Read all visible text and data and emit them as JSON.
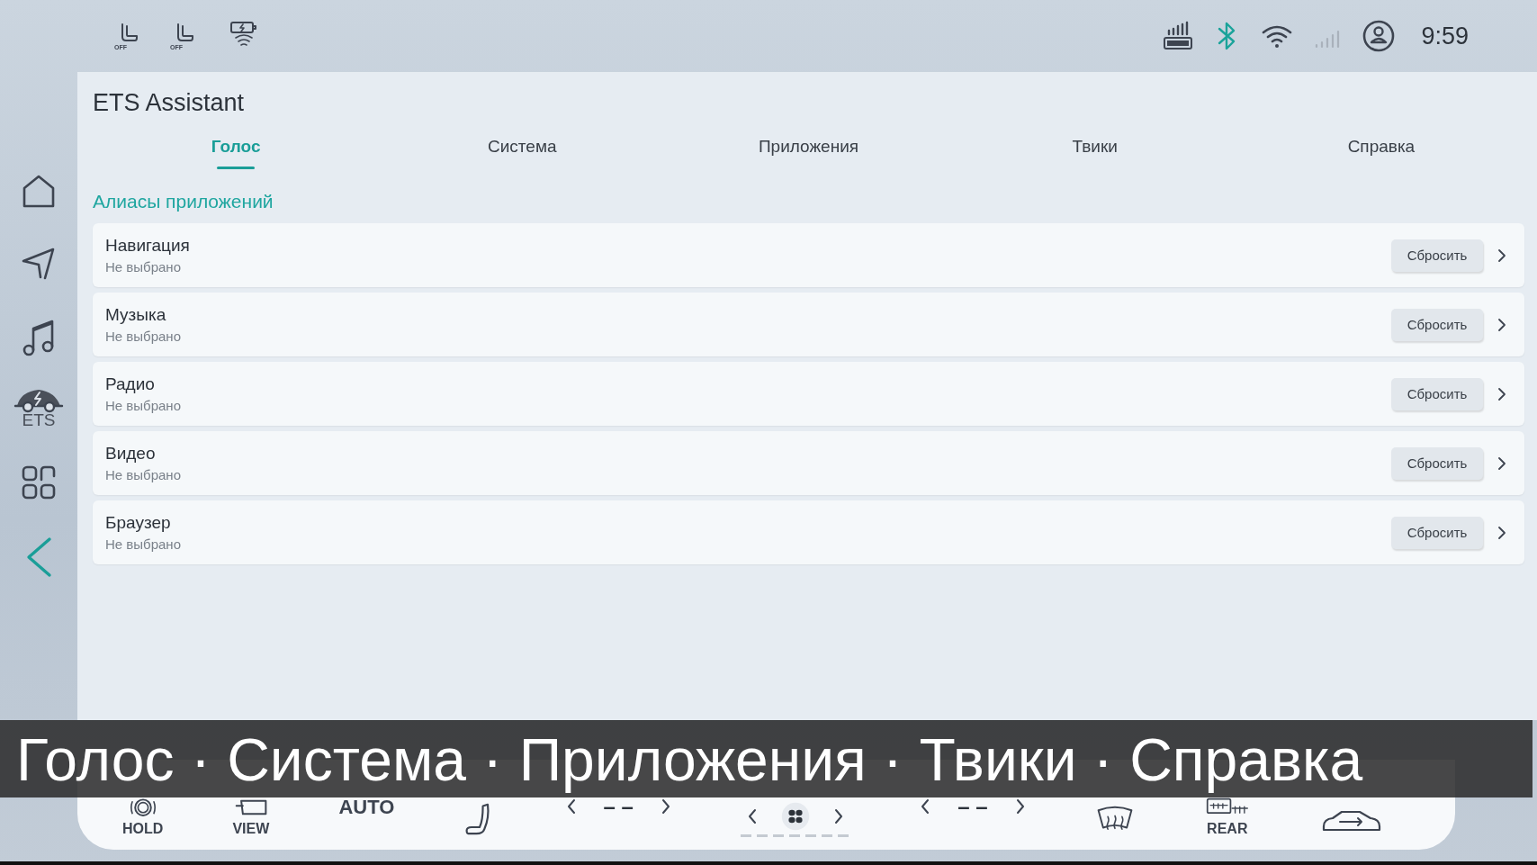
{
  "status_bar": {
    "seat_heaters": [
      {
        "label": "OFF"
      },
      {
        "label": "OFF"
      }
    ],
    "time": "9:59"
  },
  "sidebar": {
    "ets_label": "ETS"
  },
  "app": {
    "title": "ETS Assistant"
  },
  "tabs": [
    {
      "label": "Голос",
      "selected": true
    },
    {
      "label": "Система",
      "selected": false
    },
    {
      "label": "Приложения",
      "selected": false
    },
    {
      "label": "Твики",
      "selected": false
    },
    {
      "label": "Справка",
      "selected": false
    }
  ],
  "section_title": "Алиасы приложений",
  "rows": [
    {
      "title": "Навигация",
      "subtitle": "Не выбрано",
      "button": "Сбросить"
    },
    {
      "title": "Музыка",
      "subtitle": "Не выбрано",
      "button": "Сбросить"
    },
    {
      "title": "Радио",
      "subtitle": "Не выбрано",
      "button": "Сбросить"
    },
    {
      "title": "Видео",
      "subtitle": "Не выбрано",
      "button": "Сбросить"
    },
    {
      "title": "Браузер",
      "subtitle": "Не выбрано",
      "button": "Сбросить"
    }
  ],
  "climate": {
    "hold": "HOLD",
    "view": "VIEW",
    "auto": "AUTO",
    "left_temp": "– –",
    "right_temp": "– –",
    "fan": {
      "level": 0
    },
    "rear": "REAR"
  },
  "caption": "Голос · Система · Приложения · Твики · Справка"
}
